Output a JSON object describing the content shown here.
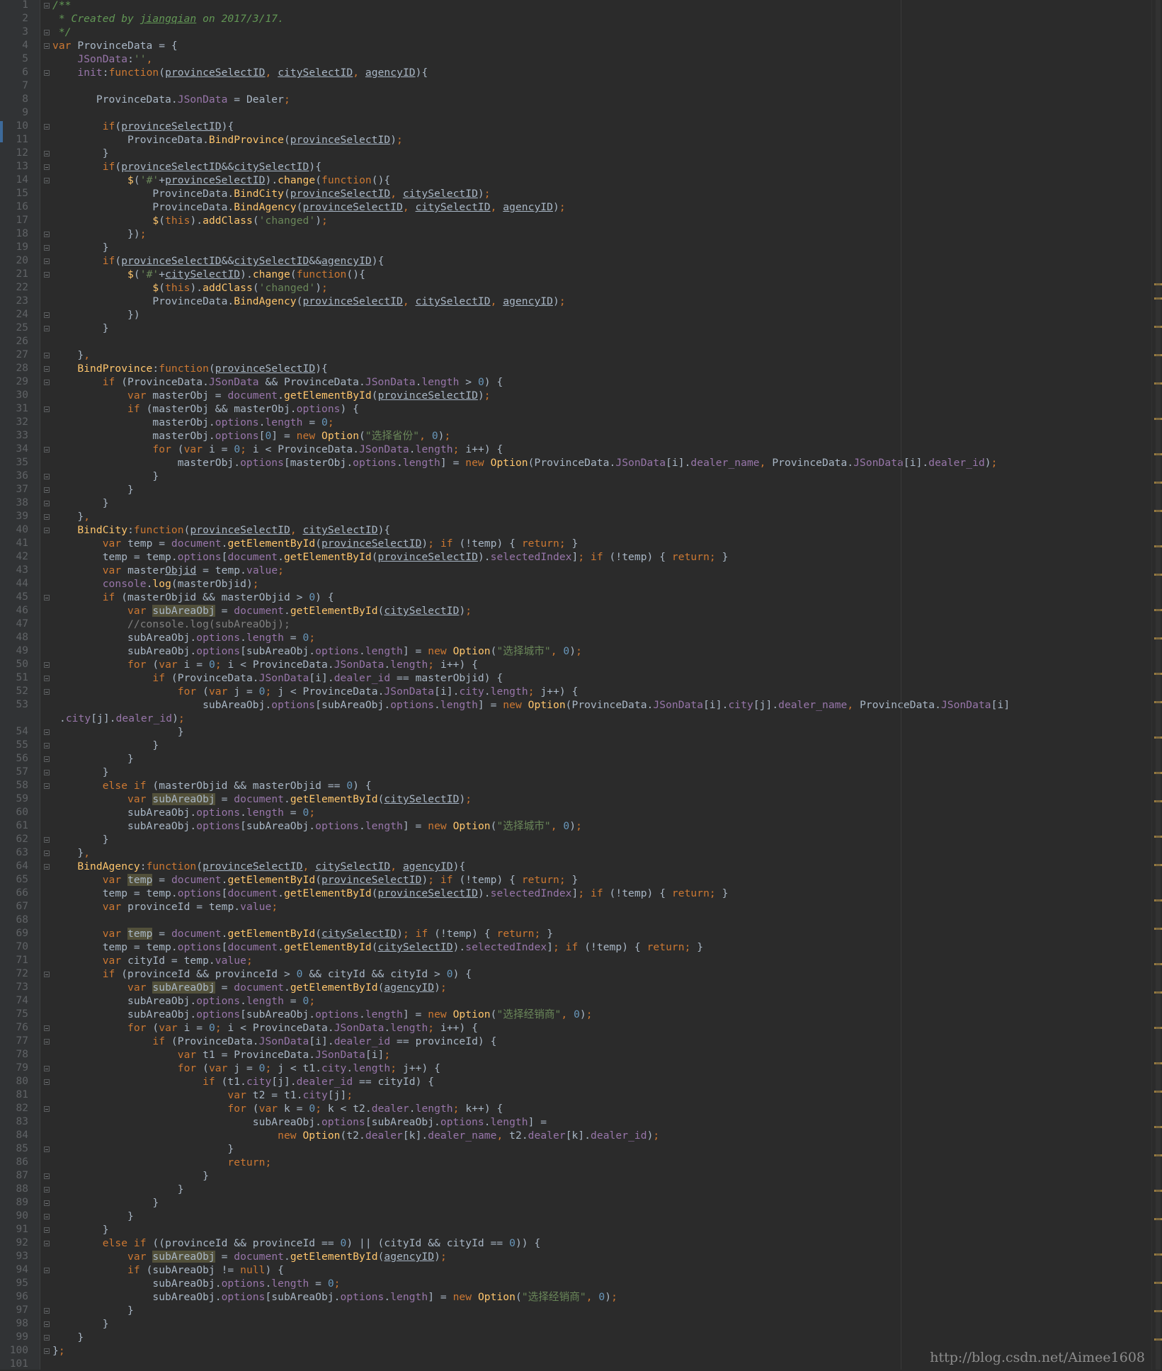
{
  "editor": {
    "language": "javascript",
    "first_line_number": 1,
    "watermark": "http://blog.csdn.net/Aimee1608",
    "colors": {
      "background": "#2b2b2b",
      "gutter": "#313335",
      "keyword": "#cc7832",
      "function": "#ffc66d",
      "property": "#9876aa",
      "string": "#6a8759",
      "number": "#6897bb",
      "comment": "#808080",
      "doc_comment": "#629755",
      "identifier": "#a9b7c6",
      "highlight": "#52503a"
    }
  },
  "lines": [
    [
      "dc:/**"
    ],
    [
      "dc: * Created by ",
      "dcu:jiangqian",
      "dc: on 2017/3/17."
    ],
    [
      "dc: */"
    ],
    [
      "kw:var ",
      "id:ProvinceData = {"
    ],
    [
      "id:    ",
      "pr:JSonData",
      "id::",
      "st:''",
      "kw:,"
    ],
    [
      "id:    ",
      "pr:init",
      "id::",
      "kw:function",
      "id:(",
      "ul:provinceSelectID",
      "kw:, ",
      "ul:citySelectID",
      "kw:, ",
      "ul:agencyID",
      "id:){"
    ],
    [],
    [
      "id:       ProvinceData.",
      "pr:JSonData",
      "id: = Dealer",
      "kw:;"
    ],
    [],
    [
      "id:        ",
      "kw:if",
      "id:(",
      "ul:provinceSelectID",
      "id:){"
    ],
    [
      "id:            ProvinceData.",
      "fn:BindProvince",
      "id:(",
      "ul:provinceSelectID",
      "id:)",
      "kw:;"
    ],
    [
      "id:        }"
    ],
    [
      "id:        ",
      "kw:if",
      "id:(",
      "ul:provinceSelectID",
      "id:&&",
      "ul:citySelectID",
      "id:){"
    ],
    [
      "id:            ",
      "fn:$",
      "id:(",
      "st:'#'",
      "id:+",
      "ul:provinceSelectID",
      "id:).",
      "fn:change",
      "id:(",
      "kw:function",
      "id:(){"
    ],
    [
      "id:                ProvinceData.",
      "fn:BindCity",
      "id:(",
      "ul:provinceSelectID",
      "kw:, ",
      "ul:citySelectID",
      "id:)",
      "kw:;"
    ],
    [
      "id:                ProvinceData.",
      "fn:BindAgency",
      "id:(",
      "ul:provinceSelectID",
      "kw:, ",
      "ul:citySelectID",
      "kw:, ",
      "ul:agencyID",
      "id:)",
      "kw:;"
    ],
    [
      "id:                ",
      "fn:$",
      "id:(",
      "kw:this",
      "id:).",
      "fn:addClass",
      "id:(",
      "st:'changed'",
      "id:)",
      "kw:;"
    ],
    [
      "id:            })",
      "kw:;"
    ],
    [
      "id:        }"
    ],
    [
      "id:        ",
      "kw:if",
      "id:(",
      "ul:provinceSelectID",
      "id:&&",
      "ul:citySelectID",
      "id:&&",
      "ul:agencyID",
      "id:){"
    ],
    [
      "id:            ",
      "fn:$",
      "id:(",
      "st:'#'",
      "id:+",
      "ul:citySelectID",
      "id:).",
      "fn:change",
      "id:(",
      "kw:function",
      "id:(){"
    ],
    [
      "id:                ",
      "fn:$",
      "id:(",
      "kw:this",
      "id:).",
      "fn:addClass",
      "id:(",
      "st:'changed'",
      "id:)",
      "kw:;"
    ],
    [
      "id:                ProvinceData.",
      "fn:BindAgency",
      "id:(",
      "ul:provinceSelectID",
      "kw:, ",
      "ul:citySelectID",
      "kw:, ",
      "ul:agencyID",
      "id:)",
      "kw:;"
    ],
    [
      "id:            })"
    ],
    [
      "id:        }"
    ],
    [],
    [
      "id:    }",
      "kw:,"
    ],
    [
      "id:    ",
      "fn:BindProvince",
      "id::",
      "kw:function",
      "id:(",
      "ul:provinceSelectID",
      "id:){"
    ],
    [
      "id:        ",
      "kw:if ",
      "id:(ProvinceData.",
      "pr:JSonData",
      "id: && ProvinceData.",
      "pr:JSonData",
      "id:.",
      "pr:length",
      "id: > ",
      "nu:0",
      "id:) {"
    ],
    [
      "id:            ",
      "kw:var ",
      "id:masterObj = ",
      "pr:document",
      "id:.",
      "fn:getElementById",
      "id:(",
      "ul:provinceSelectID",
      "id:)",
      "kw:;"
    ],
    [
      "id:            ",
      "kw:if ",
      "id:(masterObj && masterObj.",
      "pr:options",
      "id:) {"
    ],
    [
      "id:                masterObj.",
      "pr:options",
      "id:.",
      "pr:length",
      "id: = ",
      "nu:0",
      "kw:;"
    ],
    [
      "id:                masterObj.",
      "pr:options",
      "id:[",
      "nu:0",
      "id:] = ",
      "kw:new ",
      "fn:Option",
      "id:(",
      "st:\"选择省份\"",
      "kw:, ",
      "nu:0",
      "id:)",
      "kw:;"
    ],
    [
      "id:                ",
      "kw:for ",
      "id:(",
      "kw:var ",
      "id:i = ",
      "nu:0",
      "kw:; ",
      "id:i < ProvinceData.",
      "pr:JSonData",
      "id:.",
      "pr:length",
      "kw:; ",
      "id:i++) {"
    ],
    [
      "id:                    masterObj.",
      "pr:options",
      "id:[masterObj.",
      "pr:options",
      "id:.",
      "pr:length",
      "id:] = ",
      "kw:new ",
      "fn:Option",
      "id:(ProvinceData.",
      "pr:JSonData",
      "id:[i].",
      "pr:dealer_name",
      "kw:, ",
      "id:ProvinceData.",
      "pr:JSonData",
      "id:[i].",
      "pr:dealer_id",
      "id:)",
      "kw:;"
    ],
    [
      "id:                }"
    ],
    [
      "id:            }"
    ],
    [
      "id:        }"
    ],
    [
      "id:    }",
      "kw:,"
    ],
    [
      "id:    ",
      "fn:BindCity",
      "id::",
      "kw:function",
      "id:(",
      "ul:provinceSelectID",
      "kw:, ",
      "ul:citySelectID",
      "id:){"
    ],
    [
      "id:        ",
      "kw:var ",
      "id:temp = ",
      "pr:document",
      "id:.",
      "fn:getElementById",
      "id:(",
      "ul:provinceSelectID",
      "id:)",
      "kw:; if ",
      "id:(!temp) { ",
      "kw:return; ",
      "id:}"
    ],
    [
      "id:        temp = temp.",
      "pr:options",
      "id:[",
      "pr:document",
      "id:.",
      "fn:getElementById",
      "id:(",
      "ul:provinceSelectID",
      "id:).",
      "pr:selectedIndex",
      "id:]",
      "kw:; if ",
      "id:(!temp) { ",
      "kw:return; ",
      "id:}"
    ],
    [
      "id:        ",
      "kw:var ",
      "id:master",
      "ul:Objid",
      "id: = temp.",
      "pr:value",
      "kw:;"
    ],
    [
      "id:        ",
      "pr:console",
      "id:.",
      "fn:log",
      "id:(masterObjid)",
      "kw:;"
    ],
    [
      "id:        ",
      "kw:if ",
      "id:(masterObjid && masterObjid > ",
      "nu:0",
      "id:) {"
    ],
    [
      "id:            ",
      "kw:var ",
      "hl:subAreaObj",
      "id: = ",
      "pr:document",
      "id:.",
      "fn:getElementById",
      "id:(",
      "ul:citySelectID",
      "id:)",
      "kw:;"
    ],
    [
      "cm:            //console.log(subAreaObj);"
    ],
    [
      "id:            subAreaObj.",
      "pr:options",
      "id:.",
      "pr:length",
      "id: = ",
      "nu:0",
      "kw:;"
    ],
    [
      "id:            subAreaObj.",
      "pr:options",
      "id:[subAreaObj.",
      "pr:options",
      "id:.",
      "pr:length",
      "id:] = ",
      "kw:new ",
      "fn:Option",
      "id:(",
      "st:\"选择城市\"",
      "kw:, ",
      "nu:0",
      "id:)",
      "kw:;"
    ],
    [
      "id:            ",
      "kw:for ",
      "id:(",
      "kw:var ",
      "id:i = ",
      "nu:0",
      "kw:; ",
      "id:i < ProvinceData.",
      "pr:JSonData",
      "id:.",
      "pr:length",
      "kw:; ",
      "id:i++) {"
    ],
    [
      "id:                ",
      "kw:if ",
      "id:(ProvinceData.",
      "pr:JSonData",
      "id:[i].",
      "pr:dealer_id",
      "id: == masterObjid) {"
    ],
    [
      "id:                    ",
      "kw:for ",
      "id:(",
      "kw:var ",
      "id:j = ",
      "nu:0",
      "kw:; ",
      "id:j < ProvinceData.",
      "pr:JSonData",
      "id:[i].",
      "pr:city",
      "id:.",
      "pr:length",
      "kw:; ",
      "id:j++) {"
    ],
    [
      "id:                        subAreaObj.",
      "pr:options",
      "id:[subAreaObj.",
      "pr:options",
      "id:.",
      "pr:length",
      "id:] = ",
      "kw:new ",
      "fn:Option",
      "id:(ProvinceData.",
      "pr:JSonData",
      "id:[i].",
      "pr:city",
      "id:[j].",
      "pr:dealer_name",
      "kw:, ",
      "id:ProvinceData.",
      "pr:JSonData",
      "id:[i]"
    ],
    [
      "id:                    }"
    ],
    [
      "id:                }"
    ],
    [
      "id:            }"
    ],
    [
      "id:        }"
    ],
    [
      "id:        ",
      "kw:else if ",
      "id:(masterObjid && masterObjid == ",
      "nu:0",
      "id:) {"
    ],
    [
      "id:            ",
      "kw:var ",
      "hl:subAreaObj",
      "id: = ",
      "pr:document",
      "id:.",
      "fn:getElementById",
      "id:(",
      "ul:citySelectID",
      "id:)",
      "kw:;"
    ],
    [
      "id:            subAreaObj.",
      "pr:options",
      "id:.",
      "pr:length",
      "id: = ",
      "nu:0",
      "kw:;"
    ],
    [
      "id:            subAreaObj.",
      "pr:options",
      "id:[subAreaObj.",
      "pr:options",
      "id:.",
      "pr:length",
      "id:] = ",
      "kw:new ",
      "fn:Option",
      "id:(",
      "st:\"选择城市\"",
      "kw:, ",
      "nu:0",
      "id:)",
      "kw:;"
    ],
    [
      "id:        }"
    ],
    [
      "id:    }",
      "kw:,"
    ],
    [
      "id:    ",
      "fn:BindAgency",
      "id::",
      "kw:function",
      "id:(",
      "ul:provinceSelectID",
      "kw:, ",
      "ul:citySelectID",
      "kw:, ",
      "ul:agencyID",
      "id:){"
    ],
    [
      "id:        ",
      "kw:var ",
      "hl:temp",
      "id: = ",
      "pr:document",
      "id:.",
      "fn:getElementById",
      "id:(",
      "ul:provinceSelectID",
      "id:)",
      "kw:; if ",
      "id:(!temp) { ",
      "kw:return; ",
      "id:}"
    ],
    [
      "id:        temp = temp.",
      "pr:options",
      "id:[",
      "pr:document",
      "id:.",
      "fn:getElementById",
      "id:(",
      "ul:provinceSelectID",
      "id:).",
      "pr:selectedIndex",
      "id:]",
      "kw:; if ",
      "id:(!temp) { ",
      "kw:return; ",
      "id:}"
    ],
    [
      "id:        ",
      "kw:var ",
      "id:provinceId = temp.",
      "pr:value",
      "kw:;"
    ],
    [],
    [
      "id:        ",
      "kw:var ",
      "hl:temp",
      "id: = ",
      "pr:document",
      "id:.",
      "fn:getElementById",
      "id:(",
      "ul:citySelectID",
      "id:)",
      "kw:; if ",
      "id:(!temp) { ",
      "kw:return; ",
      "id:}"
    ],
    [
      "id:        temp = temp.",
      "pr:options",
      "id:[",
      "pr:document",
      "id:.",
      "fn:getElementById",
      "id:(",
      "ul:citySelectID",
      "id:).",
      "pr:selectedIndex",
      "id:]",
      "kw:; if ",
      "id:(!temp) { ",
      "kw:return; ",
      "id:}"
    ],
    [
      "id:        ",
      "kw:var ",
      "id:cityId = temp.",
      "pr:value",
      "kw:;"
    ],
    [
      "id:        ",
      "kw:if ",
      "id:(provinceId && provinceId > ",
      "nu:0",
      "id: && cityId && cityId > ",
      "nu:0",
      "id:) {"
    ],
    [
      "id:            ",
      "kw:var ",
      "hl:subAreaObj",
      "id: = ",
      "pr:document",
      "id:.",
      "fn:getElementById",
      "id:(",
      "ul:agencyID",
      "id:)",
      "kw:;"
    ],
    [
      "id:            subAreaObj.",
      "pr:options",
      "id:.",
      "pr:length",
      "id: = ",
      "nu:0",
      "kw:;"
    ],
    [
      "id:            subAreaObj.",
      "pr:options",
      "id:[subAreaObj.",
      "pr:options",
      "id:.",
      "pr:length",
      "id:] = ",
      "kw:new ",
      "fn:Option",
      "id:(",
      "st:\"选择经销商\"",
      "kw:, ",
      "nu:0",
      "id:)",
      "kw:;"
    ],
    [
      "id:            ",
      "kw:for ",
      "id:(",
      "kw:var ",
      "id:i = ",
      "nu:0",
      "kw:; ",
      "id:i < ProvinceData.",
      "pr:JSonData",
      "id:.",
      "pr:length",
      "kw:; ",
      "id:i++) {"
    ],
    [
      "id:                ",
      "kw:if ",
      "id:(ProvinceData.",
      "pr:JSonData",
      "id:[i].",
      "pr:dealer_id",
      "id: == provinceId) {"
    ],
    [
      "id:                    ",
      "kw:var ",
      "id:t1 = ProvinceData.",
      "pr:JSonData",
      "id:[i]",
      "kw:;"
    ],
    [
      "id:                    ",
      "kw:for ",
      "id:(",
      "kw:var ",
      "id:j = ",
      "nu:0",
      "kw:; ",
      "id:j < t1.",
      "pr:city",
      "id:.",
      "pr:length",
      "kw:; ",
      "id:j++) {"
    ],
    [
      "id:                        ",
      "kw:if ",
      "id:(t1.",
      "pr:city",
      "id:[j].",
      "pr:dealer_id",
      "id: == cityId) {"
    ],
    [
      "id:                            ",
      "kw:var ",
      "id:t2 = t1.",
      "pr:city",
      "id:[j]",
      "kw:;"
    ],
    [
      "id:                            ",
      "kw:for ",
      "id:(",
      "kw:var ",
      "id:k = ",
      "nu:0",
      "kw:; ",
      "id:k < t2.",
      "pr:dealer",
      "id:.",
      "pr:length",
      "kw:; ",
      "id:k++) {"
    ],
    [
      "id:                                subAreaObj.",
      "pr:options",
      "id:[subAreaObj.",
      "pr:options",
      "id:.",
      "pr:length",
      "id:] ="
    ],
    [
      "id:                                    ",
      "kw:new ",
      "fn:Option",
      "id:(t2.",
      "pr:dealer",
      "id:[k].",
      "pr:dealer_name",
      "kw:, ",
      "id:t2.",
      "pr:dealer",
      "id:[k].",
      "pr:dealer_id",
      "id:)",
      "kw:;"
    ],
    [
      "id:                            }"
    ],
    [
      "id:                            ",
      "kw:return;"
    ],
    [
      "id:                        }"
    ],
    [
      "id:                    }"
    ],
    [
      "id:                }"
    ],
    [
      "id:            }"
    ],
    [
      "id:        }"
    ],
    [
      "id:        ",
      "kw:else if ",
      "id:((provinceId && provinceId == ",
      "nu:0",
      "id:) || (cityId && cityId == ",
      "nu:0",
      "id:)) {"
    ],
    [
      "id:            ",
      "kw:var ",
      "hl:subAreaObj",
      "id: = ",
      "pr:document",
      "id:.",
      "fn:getElementById",
      "id:(",
      "ul:agencyID",
      "id:)",
      "kw:;"
    ],
    [
      "id:            ",
      "kw:if ",
      "id:(subAreaObj != ",
      "kw:null",
      "id:) {"
    ],
    [
      "id:                subAreaObj.",
      "pr:options",
      "id:.",
      "pr:length",
      "id: = ",
      "nu:0",
      "kw:;"
    ],
    [
      "id:                subAreaObj.",
      "pr:options",
      "id:[subAreaObj.",
      "pr:options",
      "id:.",
      "pr:length",
      "id:] = ",
      "kw:new ",
      "fn:Option",
      "id:(",
      "st:\"选择经销商\"",
      "kw:, ",
      "nu:0",
      "id:)",
      "kw:;"
    ],
    [
      "id:            }"
    ],
    [
      "id:        }"
    ],
    [
      "id:    }"
    ],
    [
      "id:}",
      "kw:;"
    ],
    []
  ],
  "wrapped": {
    "53": [
      ".",
      "pr:city",
      "id:[j].",
      "pr:dealer_id",
      "id:)",
      "kw:;"
    ]
  },
  "fold_lines": [
    1,
    3,
    4,
    6,
    10,
    12,
    13,
    14,
    18,
    19,
    20,
    21,
    24,
    25,
    27,
    28,
    29,
    31,
    34,
    36,
    37,
    38,
    39,
    40,
    45,
    50,
    51,
    52,
    54,
    55,
    56,
    57,
    58,
    62,
    63,
    64,
    72,
    76,
    77,
    79,
    80,
    82,
    85,
    87,
    88,
    89,
    90,
    91,
    92,
    94,
    97,
    98,
    99,
    100
  ]
}
